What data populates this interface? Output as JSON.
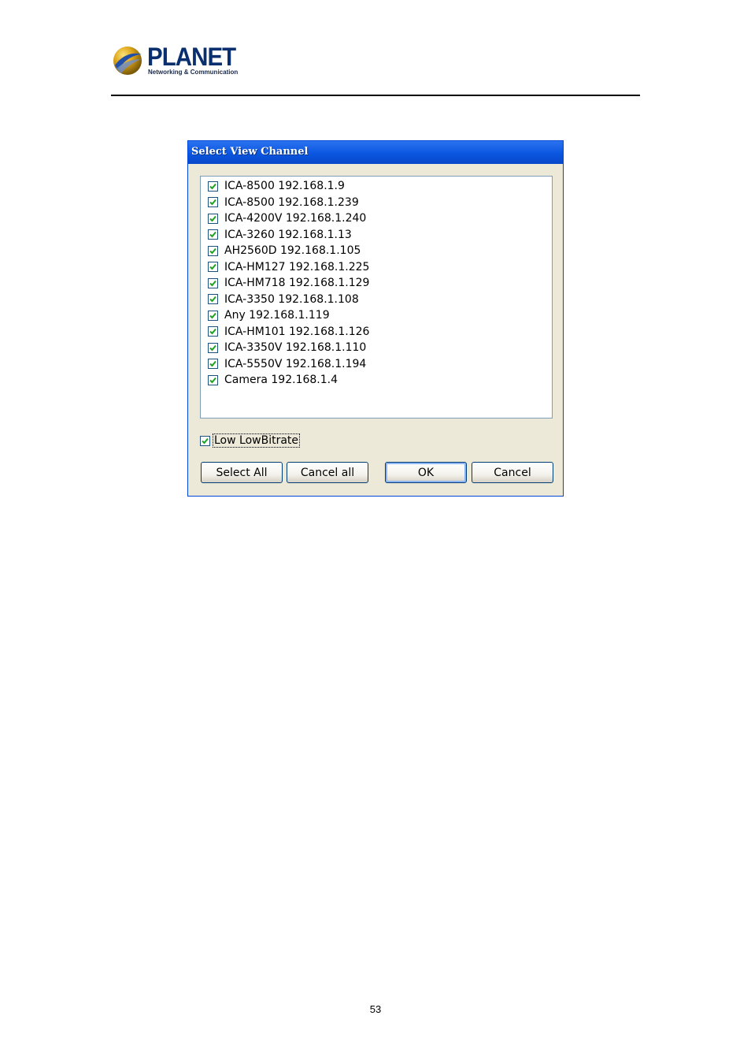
{
  "header": {
    "logo_word": "PLANET",
    "logo_tagline": "Networking & Communication"
  },
  "dialog": {
    "title": "Select View Channel",
    "channels": [
      {
        "label": "ICA-8500 192.168.1.9",
        "checked": true
      },
      {
        "label": "ICA-8500 192.168.1.239",
        "checked": true
      },
      {
        "label": "ICA-4200V 192.168.1.240",
        "checked": true
      },
      {
        "label": "ICA-3260 192.168.1.13",
        "checked": true
      },
      {
        "label": "AH2560D 192.168.1.105",
        "checked": true
      },
      {
        "label": "ICA-HM127 192.168.1.225",
        "checked": true
      },
      {
        "label": "ICA-HM718 192.168.1.129",
        "checked": true
      },
      {
        "label": "ICA-3350 192.168.1.108",
        "checked": true
      },
      {
        "label": "Any 192.168.1.119",
        "checked": true
      },
      {
        "label": "ICA-HM101 192.168.1.126",
        "checked": true
      },
      {
        "label": "ICA-3350V 192.168.1.110",
        "checked": true
      },
      {
        "label": "ICA-5550V 192.168.1.194",
        "checked": true
      },
      {
        "label": "Camera 192.168.1.4",
        "checked": true
      }
    ],
    "low_bitrate": {
      "label": "Low LowBitrate",
      "checked": true
    },
    "buttons": {
      "select_all": "Select All",
      "cancel_all": "Cancel all",
      "ok": "OK",
      "cancel": "Cancel"
    }
  },
  "footer": {
    "page_number": "53"
  },
  "colors": {
    "titlebar": "#0a56e0",
    "dialog_bg": "#ece9d8",
    "checkmark": "#21a121",
    "brand": "#0a2f6e"
  }
}
